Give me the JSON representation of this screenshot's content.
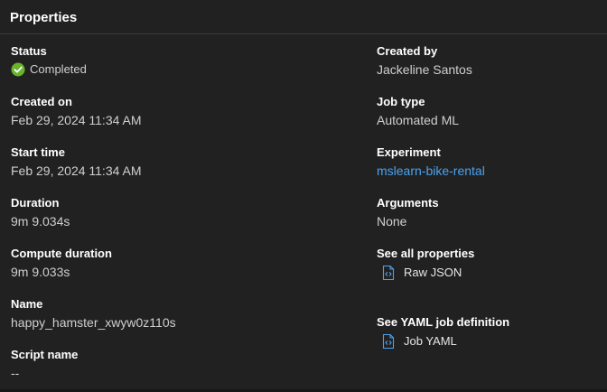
{
  "panel": {
    "title": "Properties"
  },
  "left": {
    "status": {
      "label": "Status",
      "value": "Completed",
      "icon": "check-circle-icon",
      "color": "#6ab42d"
    },
    "created_on": {
      "label": "Created on",
      "value": "Feb 29, 2024 11:34 AM"
    },
    "start_time": {
      "label": "Start time",
      "value": "Feb 29, 2024 11:34 AM"
    },
    "duration": {
      "label": "Duration",
      "value": "9m 9.034s"
    },
    "compute_duration": {
      "label": "Compute duration",
      "value": "9m 9.033s"
    },
    "name": {
      "label": "Name",
      "value": "happy_hamster_xwyw0z110s"
    },
    "script_name": {
      "label": "Script name",
      "value": "--"
    }
  },
  "right": {
    "created_by": {
      "label": "Created by",
      "value": "Jackeline Santos"
    },
    "job_type": {
      "label": "Job type",
      "value": "Automated ML"
    },
    "experiment": {
      "label": "Experiment",
      "value": "mslearn-bike-rental",
      "color": "#4aa3f0"
    },
    "arguments": {
      "label": "Arguments",
      "value": "None"
    },
    "all_properties": {
      "label": "See all properties",
      "link": "Raw JSON",
      "icon": "code-file-icon"
    },
    "yaml_definition": {
      "label": "See YAML job definition",
      "link": "Job YAML",
      "icon": "code-file-icon"
    }
  }
}
